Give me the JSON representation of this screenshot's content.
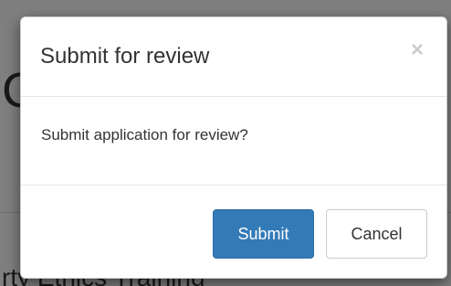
{
  "background": {
    "glyph": "C",
    "text": "rty Ethics Training"
  },
  "dialog": {
    "title": "Submit for review",
    "close_icon": "×",
    "message": "Submit application for review?",
    "submit_label": "Submit",
    "cancel_label": "Cancel"
  },
  "colors": {
    "primary": "#337ab7",
    "backdrop": "rgba(0,0,0,0.5)"
  }
}
